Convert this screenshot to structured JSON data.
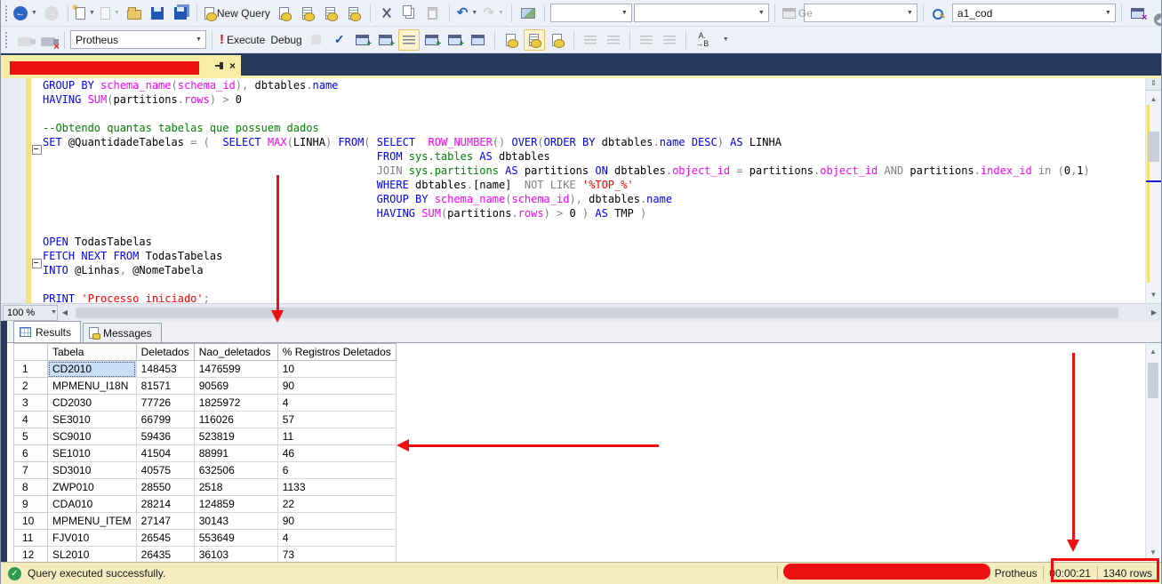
{
  "toolbars": {
    "row1": {
      "new_query_label": "New Query",
      "ge_label": "Ge",
      "combo1_value": "",
      "combo2_value": "",
      "combo3_value": "",
      "search_value": "a1_cod"
    },
    "row2": {
      "database": "Protheus",
      "execute_label": "Execute",
      "debug_label": "Debug"
    }
  },
  "tab": {
    "title_redacted": true
  },
  "editor": {
    "zoom_level": "100 %",
    "lines": [
      {
        "ind": 0,
        "fold": false,
        "tokens": [
          [
            "k",
            "GROUP BY "
          ],
          [
            "f",
            "schema_name"
          ],
          [
            "g",
            "("
          ],
          [
            "f",
            "schema_id"
          ],
          [
            "g",
            "), "
          ],
          [
            "p",
            "dbtables"
          ],
          [
            "g",
            "."
          ],
          [
            "k",
            "name"
          ]
        ]
      },
      {
        "ind": 0,
        "fold": false,
        "tokens": [
          [
            "k",
            "HAVING "
          ],
          [
            "f",
            "SUM"
          ],
          [
            "g",
            "("
          ],
          [
            "p",
            "partitions"
          ],
          [
            "g",
            "."
          ],
          [
            "f",
            "rows"
          ],
          [
            "g",
            ") > "
          ],
          [
            "p",
            "0"
          ]
        ]
      },
      {
        "ind": 0,
        "fold": false,
        "tokens": []
      },
      {
        "ind": 0,
        "fold": false,
        "tokens": [
          [
            "c",
            "--Obtendo quantas tabelas que possuem dados"
          ]
        ]
      },
      {
        "ind": 0,
        "fold": true,
        "tokens": [
          [
            "k",
            "SET "
          ],
          [
            "p",
            "@QuantidadeTabelas "
          ],
          [
            "g",
            "= (  "
          ],
          [
            "k",
            "SELECT "
          ],
          [
            "f",
            "MAX"
          ],
          [
            "g",
            "("
          ],
          [
            "p",
            "LINHA"
          ],
          [
            "g",
            ") "
          ],
          [
            "k",
            "FROM"
          ],
          [
            "g",
            "( "
          ],
          [
            "k",
            "SELECT  "
          ],
          [
            "f",
            "ROW_NUMBER"
          ],
          [
            "g",
            "() "
          ],
          [
            "k",
            "OVER"
          ],
          [
            "g",
            "("
          ],
          [
            "k",
            "ORDER BY "
          ],
          [
            "p",
            "dbtables"
          ],
          [
            "g",
            "."
          ],
          [
            "k",
            "name "
          ],
          [
            "k",
            "DESC"
          ],
          [
            "g",
            ") "
          ],
          [
            "k",
            "AS "
          ],
          [
            "p",
            "LINHA"
          ]
        ]
      },
      {
        "ind": 52,
        "fold": false,
        "tokens": [
          [
            "k",
            "FROM "
          ],
          [
            "t",
            "sys.tables "
          ],
          [
            "k",
            "AS "
          ],
          [
            "p",
            "dbtables"
          ]
        ]
      },
      {
        "ind": 52,
        "fold": false,
        "tokens": [
          [
            "g",
            "JOIN "
          ],
          [
            "t",
            "sys.partitions "
          ],
          [
            "k",
            "AS "
          ],
          [
            "p",
            "partitions "
          ],
          [
            "k",
            "ON "
          ],
          [
            "p",
            "dbtables"
          ],
          [
            "g",
            "."
          ],
          [
            "f",
            "object_id "
          ],
          [
            "g",
            "= "
          ],
          [
            "p",
            "partitions"
          ],
          [
            "g",
            "."
          ],
          [
            "f",
            "object_id "
          ],
          [
            "g",
            "AND "
          ],
          [
            "p",
            "partitions"
          ],
          [
            "g",
            "."
          ],
          [
            "f",
            "index_id "
          ],
          [
            "g",
            "in ("
          ],
          [
            "p",
            "0"
          ],
          [
            "g",
            ","
          ],
          [
            "p",
            "1"
          ],
          [
            "g",
            ")"
          ]
        ]
      },
      {
        "ind": 52,
        "fold": false,
        "tokens": [
          [
            "k",
            "WHERE "
          ],
          [
            "p",
            "dbtables"
          ],
          [
            "g",
            "."
          ],
          [
            "p",
            "[name]  "
          ],
          [
            "g",
            "NOT LIKE "
          ],
          [
            "s",
            "'%TOP_%'"
          ]
        ]
      },
      {
        "ind": 52,
        "fold": false,
        "tokens": [
          [
            "k",
            "GROUP BY "
          ],
          [
            "f",
            "schema_name"
          ],
          [
            "g",
            "("
          ],
          [
            "f",
            "schema_id"
          ],
          [
            "g",
            "), "
          ],
          [
            "p",
            "dbtables"
          ],
          [
            "g",
            "."
          ],
          [
            "k",
            "name"
          ]
        ]
      },
      {
        "ind": 52,
        "fold": false,
        "tokens": [
          [
            "k",
            "HAVING "
          ],
          [
            "f",
            "SUM"
          ],
          [
            "g",
            "("
          ],
          [
            "p",
            "partitions"
          ],
          [
            "g",
            "."
          ],
          [
            "f",
            "rows"
          ],
          [
            "g",
            ") > "
          ],
          [
            "p",
            "0"
          ],
          [
            "g",
            " ) "
          ],
          [
            "k",
            "AS "
          ],
          [
            "p",
            "TMP "
          ],
          [
            "g",
            ")"
          ]
        ]
      },
      {
        "ind": 0,
        "fold": false,
        "tokens": []
      },
      {
        "ind": 0,
        "fold": false,
        "tokens": [
          [
            "k",
            "OPEN "
          ],
          [
            "p",
            "TodasTabelas"
          ]
        ]
      },
      {
        "ind": 0,
        "fold": true,
        "tokens": [
          [
            "k",
            "FETCH NEXT FROM "
          ],
          [
            "p",
            "TodasTabelas"
          ]
        ]
      },
      {
        "ind": 0,
        "fold": false,
        "tokens": [
          [
            "k",
            "INTO "
          ],
          [
            "p",
            "@Linhas"
          ],
          [
            "g",
            ", "
          ],
          [
            "p",
            "@NomeTabela"
          ]
        ]
      },
      {
        "ind": 0,
        "fold": false,
        "tokens": []
      },
      {
        "ind": 0,
        "fold": false,
        "tokens": [
          [
            "k",
            "PRINT "
          ],
          [
            "s",
            "'Processo iniciado'"
          ],
          [
            "g",
            ";"
          ]
        ]
      }
    ]
  },
  "results": {
    "tabs": [
      {
        "label": "Results"
      },
      {
        "label": "Messages"
      }
    ],
    "grid": {
      "headers": [
        "Tabela",
        "Deletados",
        "Nao_deletados",
        "% Registros Deletados"
      ],
      "rows": [
        [
          "CD2010",
          "148453",
          "1476599",
          "10"
        ],
        [
          "MPMENU_I18N",
          "81571",
          "90569",
          "90"
        ],
        [
          "CD2030",
          "77726",
          "1825972",
          "4"
        ],
        [
          "SE3010",
          "66799",
          "116026",
          "57"
        ],
        [
          "SC9010",
          "59436",
          "523819",
          "11"
        ],
        [
          "SE1010",
          "41504",
          "88991",
          "46"
        ],
        [
          "SD3010",
          "40575",
          "632506",
          "6"
        ],
        [
          "ZWP010",
          "28550",
          "2518",
          "1133"
        ],
        [
          "CDA010",
          "28214",
          "124859",
          "22"
        ],
        [
          "MPMENU_ITEM",
          "27147",
          "30143",
          "90"
        ],
        [
          "FJV010",
          "26545",
          "553649",
          "4"
        ],
        [
          "SL2010",
          "26435",
          "36103",
          "73"
        ]
      ],
      "selected": {
        "row": 1,
        "column": "Tabela"
      }
    }
  },
  "statusbar": {
    "message": "Query executed successfully.",
    "server": "Protheus",
    "duration": "00:00:21",
    "rowcount": "1340 rows"
  },
  "colors": {
    "annotation_red": "#ee1010",
    "tab_yellow": "#f8eda6",
    "tabstrip_navy": "#263a5e",
    "status_yellow": "#f2ecbf",
    "keyword_blue": "#0000ff",
    "function_magenta": "#ff00ff",
    "string_red": "#ff0000",
    "comment_green": "#008000",
    "operator_gray": "#808080"
  }
}
